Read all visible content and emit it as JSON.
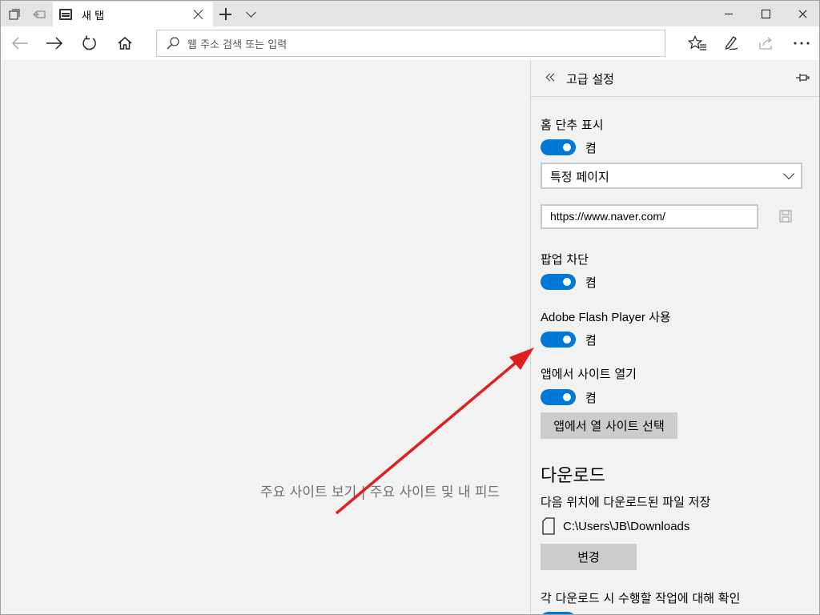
{
  "tab": {
    "title": "새 탭"
  },
  "address": {
    "placeholder": "웹 주소 검색 또는 입력"
  },
  "page": {
    "center_text": "주요 사이트 보기 | 주요 사이트 및 내 피드"
  },
  "settings": {
    "title": "고급 설정",
    "home_button": {
      "label": "홈 단추 표시",
      "state": "켬",
      "select_value": "특정 페이지",
      "url_value": "https://www.naver.com/"
    },
    "popup": {
      "label": "팝업 차단",
      "state": "켬"
    },
    "flash": {
      "label": "Adobe Flash Player 사용",
      "state": "켬"
    },
    "open_in_apps": {
      "label": "앱에서 사이트 열기",
      "state": "켬",
      "button": "앱에서 열 사이트 선택"
    },
    "downloads": {
      "heading": "다운로드",
      "label": "다음 위치에 다운로드된 파일 저장",
      "path": "C:\\Users\\JB\\Downloads",
      "change_button": "변경",
      "ask_label": "각 다운로드 시 수행할 작업에 대해 확인"
    }
  },
  "colors": {
    "accent": "#0078d7",
    "annotation_arrow": "#e02020"
  }
}
